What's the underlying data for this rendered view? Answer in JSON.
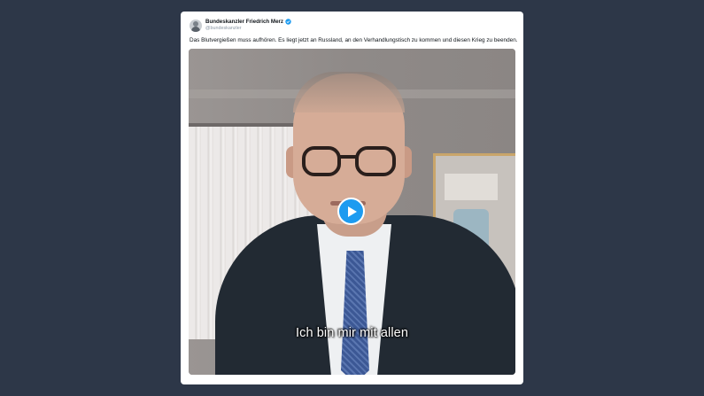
{
  "tweet": {
    "author_name": "Bundeskanzler Friedrich Merz",
    "author_handle": "@bundeskanzler",
    "text": "Das Blutvergießen muss aufhören. Es liegt jetzt an Russland, an den Verhandlungstisch zu kommen und diesen Krieg zu beenden."
  },
  "video": {
    "subtitle": "Ich bin mir mit allen"
  },
  "colors": {
    "background": "#2d3748",
    "card": "#ffffff",
    "accent": "#1d9bf0",
    "text": "#0f1419",
    "muted": "#8b98a5"
  },
  "icons": {
    "verified": "verified-badge-icon",
    "play": "play-icon"
  }
}
